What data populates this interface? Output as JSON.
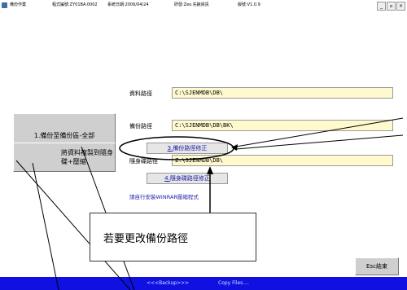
{
  "titlebar": {
    "app_name": "備份作業",
    "program_id": "程式編號:ZY01BA.0002",
    "system_date": "系統日期:2006/04/24",
    "developer": "研發:Zeo.先銳資訊",
    "version": "版號:V1.0.9",
    "min": "_",
    "restore": "▫",
    "close": "×"
  },
  "buttons": {
    "backup_full": "1.備份至備份區-全部",
    "copy_portable": "將資料複製到隨身碟+壓縮",
    "path_correct_3_num": "3.",
    "path_correct_3_text": "備份路徑修正",
    "path_correct_4_num": "4.",
    "path_correct_4_text": "隨身碟路徑修正",
    "exit": "Esc結束"
  },
  "fields": {
    "data_path_label": "資料路徑",
    "data_path_value": "C:\\SJENMDB\\DB\\",
    "backup_path_label": "備份路徑",
    "backup_path_value": "C:\\SJENMDB\\DB\\BK\\",
    "usb_path_label": "隨身碟路徑",
    "usb_path_value": "Z:\\SJENMDB\\DB\\"
  },
  "note": "請自行安裝WINRAR壓縮程式",
  "callout_text": "若要更改備份路徑",
  "statusbar": {
    "left": "<<<Backup>>>",
    "right": "Copy Files...."
  },
  "colors": {
    "field_bg": "#fffacd",
    "status_bar": "#1010e0",
    "button_face": "#cfcfcf",
    "link_text": "#1a1aaa"
  }
}
